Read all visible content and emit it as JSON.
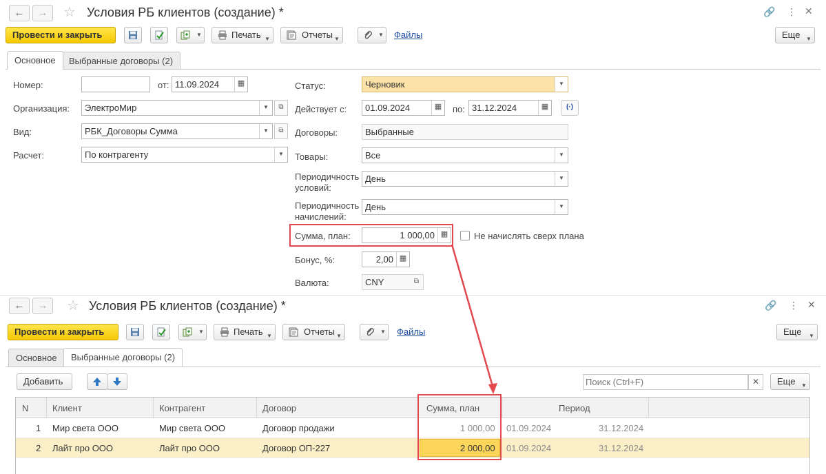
{
  "window_top": {
    "title": "Условия РБ клиентов (создание) *",
    "post_close_label": "Провести и закрыть",
    "print_label": "Печать",
    "reports_label": "Отчеты",
    "files_label": "Файлы",
    "more_label": "Еще",
    "tabs": [
      {
        "label": "Основное"
      },
      {
        "label": "Выбранные договоры (2)"
      }
    ],
    "form": {
      "number_label": "Номер:",
      "number_value": "",
      "from_label": "от:",
      "date_value": "11.09.2024",
      "org_label": "Организация:",
      "org_value": "ЭлектроМир",
      "kind_label": "Вид:",
      "kind_value": "РБК_Договоры Сумма",
      "calc_label": "Расчет:",
      "calc_value": "По контрагенту",
      "status_label": "Статус:",
      "status_value": "Черновик",
      "valid_label": "Действует с:",
      "valid_from": "01.09.2024",
      "to_label": "по:",
      "valid_to": "31.12.2024",
      "contracts_label": "Договоры:",
      "contracts_value": "Выбранные",
      "goods_label": "Товары:",
      "goods_value": "Все",
      "period_cond_label_1": "Периодичность",
      "period_cond_label_2": "условий:",
      "period_cond_value": "День",
      "period_acc_label_1": "Периодичность",
      "period_acc_label_2": "начислений:",
      "period_acc_value": "День",
      "sum_label": "Сумма, план:",
      "sum_value": "1 000,00",
      "no_over_label": "Не начислять сверх плана",
      "bonus_label": "Бонус, %:",
      "bonus_value": "2,00",
      "currency_label": "Валюта:",
      "currency_value": "CNY"
    }
  },
  "window_bottom": {
    "title": "Условия РБ клиентов (создание) *",
    "post_close_label": "Провести и закрыть",
    "print_label": "Печать",
    "reports_label": "Отчеты",
    "files_label": "Файлы",
    "more_label": "Еще",
    "tabs": [
      {
        "label": "Основное"
      },
      {
        "label": "Выбранные договоры (2)"
      }
    ],
    "add_label": "Добавить",
    "search_placeholder": "Поиск (Ctrl+F)",
    "more_table_label": "Еще",
    "columns": [
      "N",
      "Клиент",
      "Контрагент",
      "Договор",
      "Сумма, план",
      "Период"
    ],
    "rows": [
      {
        "n": "1",
        "client": "Мир света ООО",
        "counterparty": "Мир света ООО",
        "contract": "Договор продажи",
        "sum": "1 000,00",
        "from": "01.09.2024",
        "to": "31.12.2024"
      },
      {
        "n": "2",
        "client": "Лайт про ООО",
        "counterparty": "Лайт про ООО",
        "contract": "Договор ОП-227",
        "sum": "2 000,00",
        "from": "01.09.2024",
        "to": "31.12.2024"
      }
    ]
  },
  "colors": {
    "accent_yellow": "#f5c800",
    "status_fill": "#fbe3a8",
    "highlight_red": "#e3484e",
    "selected_row": "#fbefc7",
    "link_blue": "#1d4e9e"
  }
}
